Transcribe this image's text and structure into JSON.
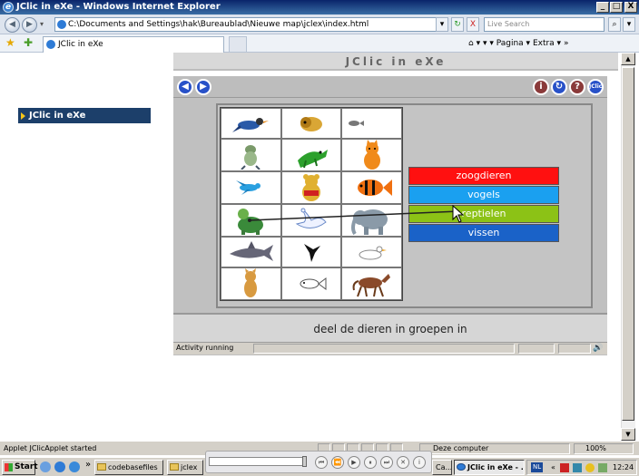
{
  "window": {
    "title": "JClic in eXe - Windows Internet Explorer",
    "min": "_",
    "max": "□",
    "close": "X"
  },
  "browser": {
    "address": "C:\\Documents and Settings\\hak\\Bureaublad\\Nieuwe map\\jclex\\index.html",
    "go": "↻",
    "stop": "X",
    "search_placeholder": "Live Search",
    "tab_title": "JClic in eXe",
    "tools_text": "▾  ▾  ▾ Pagina ▾  Extra ▾",
    "status_text": "Applet JClicApplet started",
    "zone_text": "Deze computer",
    "zoom": "100%"
  },
  "page": {
    "header": "JClic in eXe",
    "nav_item": "JClic in eXe"
  },
  "applet": {
    "categories": [
      {
        "label": "zoogdieren",
        "color": "#ff1010"
      },
      {
        "label": "vogels",
        "color": "#1aa0f0"
      },
      {
        "label": "reptielen",
        "color": "#8cc216"
      },
      {
        "label": "vissen",
        "color": "#1a62c8"
      }
    ],
    "message": "deel de dieren in groepen in",
    "status": "Activity running",
    "animals": [
      "bird-bluejay",
      "lion",
      "small-fish",
      "frog-standing",
      "crocodile",
      "cat",
      "bird-flying",
      "bear",
      "goldfish",
      "turtle",
      "swan",
      "elephant",
      "shark",
      "crow",
      "duck",
      "squirrel",
      "fish-sketch",
      "horse"
    ],
    "icons": {
      "prev": "◀",
      "next": "▶",
      "info": "i",
      "restart": "↻",
      "help": "?",
      "jclic": "JClic"
    }
  },
  "taskbar": {
    "start": "Start",
    "items": [
      "codebasefiles",
      "jclex",
      "Ca...",
      "JClic in eXe - ..."
    ],
    "lang": "NL",
    "clock": "12:24"
  }
}
